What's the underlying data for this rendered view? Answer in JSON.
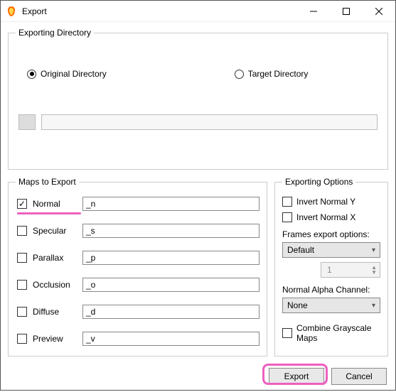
{
  "window": {
    "title": "Export"
  },
  "groups": {
    "directory": "Exporting Directory",
    "maps": "Maps to Export",
    "options": "Exporting Options"
  },
  "directory": {
    "original": "Original Directory",
    "target": "Target Directory",
    "selected": "original",
    "path": ""
  },
  "maps": [
    {
      "key": "normal",
      "label": "Normal",
      "suffix": "_n",
      "checked": true
    },
    {
      "key": "specular",
      "label": "Specular",
      "suffix": "_s",
      "checked": false
    },
    {
      "key": "parallax",
      "label": "Parallax",
      "suffix": "_p",
      "checked": false
    },
    {
      "key": "occlusion",
      "label": "Occlusion",
      "suffix": "_o",
      "checked": false
    },
    {
      "key": "diffuse",
      "label": "Diffuse",
      "suffix": "_d",
      "checked": false
    },
    {
      "key": "preview",
      "label": "Preview",
      "suffix": "_v",
      "checked": false
    }
  ],
  "options": {
    "invert_y": {
      "label": "Invert Normal Y",
      "checked": false
    },
    "invert_x": {
      "label": "Invert Normal X",
      "checked": false
    },
    "frames_label": "Frames export options:",
    "frames_value": "Default",
    "frames_count": "1",
    "alpha_label": "Normal Alpha Channel:",
    "alpha_value": "None",
    "combine": {
      "label": "Combine Grayscale Maps",
      "checked": false
    }
  },
  "footer": {
    "export": "Export",
    "cancel": "Cancel"
  }
}
